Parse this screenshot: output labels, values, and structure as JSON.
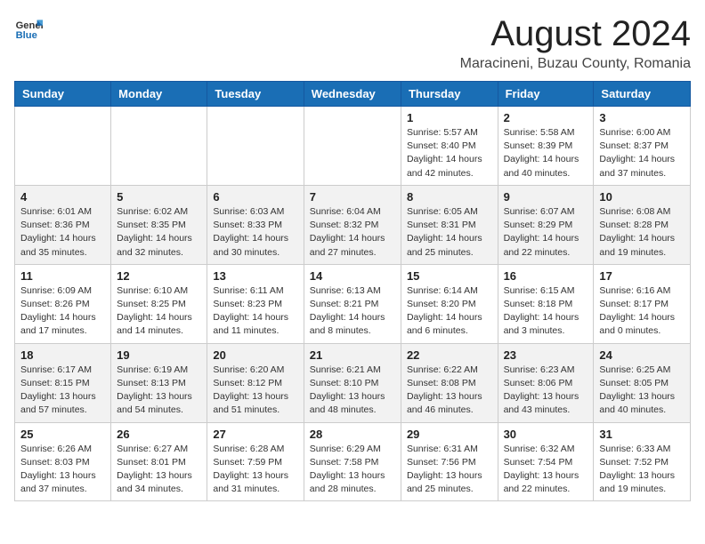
{
  "header": {
    "logo_general": "General",
    "logo_blue": "Blue",
    "title": "August 2024",
    "location": "Maracineni, Buzau County, Romania"
  },
  "weekdays": [
    "Sunday",
    "Monday",
    "Tuesday",
    "Wednesday",
    "Thursday",
    "Friday",
    "Saturday"
  ],
  "weeks": [
    [
      {
        "day": "",
        "info": ""
      },
      {
        "day": "",
        "info": ""
      },
      {
        "day": "",
        "info": ""
      },
      {
        "day": "",
        "info": ""
      },
      {
        "day": "1",
        "info": "Sunrise: 5:57 AM\nSunset: 8:40 PM\nDaylight: 14 hours\nand 42 minutes."
      },
      {
        "day": "2",
        "info": "Sunrise: 5:58 AM\nSunset: 8:39 PM\nDaylight: 14 hours\nand 40 minutes."
      },
      {
        "day": "3",
        "info": "Sunrise: 6:00 AM\nSunset: 8:37 PM\nDaylight: 14 hours\nand 37 minutes."
      }
    ],
    [
      {
        "day": "4",
        "info": "Sunrise: 6:01 AM\nSunset: 8:36 PM\nDaylight: 14 hours\nand 35 minutes."
      },
      {
        "day": "5",
        "info": "Sunrise: 6:02 AM\nSunset: 8:35 PM\nDaylight: 14 hours\nand 32 minutes."
      },
      {
        "day": "6",
        "info": "Sunrise: 6:03 AM\nSunset: 8:33 PM\nDaylight: 14 hours\nand 30 minutes."
      },
      {
        "day": "7",
        "info": "Sunrise: 6:04 AM\nSunset: 8:32 PM\nDaylight: 14 hours\nand 27 minutes."
      },
      {
        "day": "8",
        "info": "Sunrise: 6:05 AM\nSunset: 8:31 PM\nDaylight: 14 hours\nand 25 minutes."
      },
      {
        "day": "9",
        "info": "Sunrise: 6:07 AM\nSunset: 8:29 PM\nDaylight: 14 hours\nand 22 minutes."
      },
      {
        "day": "10",
        "info": "Sunrise: 6:08 AM\nSunset: 8:28 PM\nDaylight: 14 hours\nand 19 minutes."
      }
    ],
    [
      {
        "day": "11",
        "info": "Sunrise: 6:09 AM\nSunset: 8:26 PM\nDaylight: 14 hours\nand 17 minutes."
      },
      {
        "day": "12",
        "info": "Sunrise: 6:10 AM\nSunset: 8:25 PM\nDaylight: 14 hours\nand 14 minutes."
      },
      {
        "day": "13",
        "info": "Sunrise: 6:11 AM\nSunset: 8:23 PM\nDaylight: 14 hours\nand 11 minutes."
      },
      {
        "day": "14",
        "info": "Sunrise: 6:13 AM\nSunset: 8:21 PM\nDaylight: 14 hours\nand 8 minutes."
      },
      {
        "day": "15",
        "info": "Sunrise: 6:14 AM\nSunset: 8:20 PM\nDaylight: 14 hours\nand 6 minutes."
      },
      {
        "day": "16",
        "info": "Sunrise: 6:15 AM\nSunset: 8:18 PM\nDaylight: 14 hours\nand 3 minutes."
      },
      {
        "day": "17",
        "info": "Sunrise: 6:16 AM\nSunset: 8:17 PM\nDaylight: 14 hours\nand 0 minutes."
      }
    ],
    [
      {
        "day": "18",
        "info": "Sunrise: 6:17 AM\nSunset: 8:15 PM\nDaylight: 13 hours\nand 57 minutes."
      },
      {
        "day": "19",
        "info": "Sunrise: 6:19 AM\nSunset: 8:13 PM\nDaylight: 13 hours\nand 54 minutes."
      },
      {
        "day": "20",
        "info": "Sunrise: 6:20 AM\nSunset: 8:12 PM\nDaylight: 13 hours\nand 51 minutes."
      },
      {
        "day": "21",
        "info": "Sunrise: 6:21 AM\nSunset: 8:10 PM\nDaylight: 13 hours\nand 48 minutes."
      },
      {
        "day": "22",
        "info": "Sunrise: 6:22 AM\nSunset: 8:08 PM\nDaylight: 13 hours\nand 46 minutes."
      },
      {
        "day": "23",
        "info": "Sunrise: 6:23 AM\nSunset: 8:06 PM\nDaylight: 13 hours\nand 43 minutes."
      },
      {
        "day": "24",
        "info": "Sunrise: 6:25 AM\nSunset: 8:05 PM\nDaylight: 13 hours\nand 40 minutes."
      }
    ],
    [
      {
        "day": "25",
        "info": "Sunrise: 6:26 AM\nSunset: 8:03 PM\nDaylight: 13 hours\nand 37 minutes."
      },
      {
        "day": "26",
        "info": "Sunrise: 6:27 AM\nSunset: 8:01 PM\nDaylight: 13 hours\nand 34 minutes."
      },
      {
        "day": "27",
        "info": "Sunrise: 6:28 AM\nSunset: 7:59 PM\nDaylight: 13 hours\nand 31 minutes."
      },
      {
        "day": "28",
        "info": "Sunrise: 6:29 AM\nSunset: 7:58 PM\nDaylight: 13 hours\nand 28 minutes."
      },
      {
        "day": "29",
        "info": "Sunrise: 6:31 AM\nSunset: 7:56 PM\nDaylight: 13 hours\nand 25 minutes."
      },
      {
        "day": "30",
        "info": "Sunrise: 6:32 AM\nSunset: 7:54 PM\nDaylight: 13 hours\nand 22 minutes."
      },
      {
        "day": "31",
        "info": "Sunrise: 6:33 AM\nSunset: 7:52 PM\nDaylight: 13 hours\nand 19 minutes."
      }
    ]
  ]
}
